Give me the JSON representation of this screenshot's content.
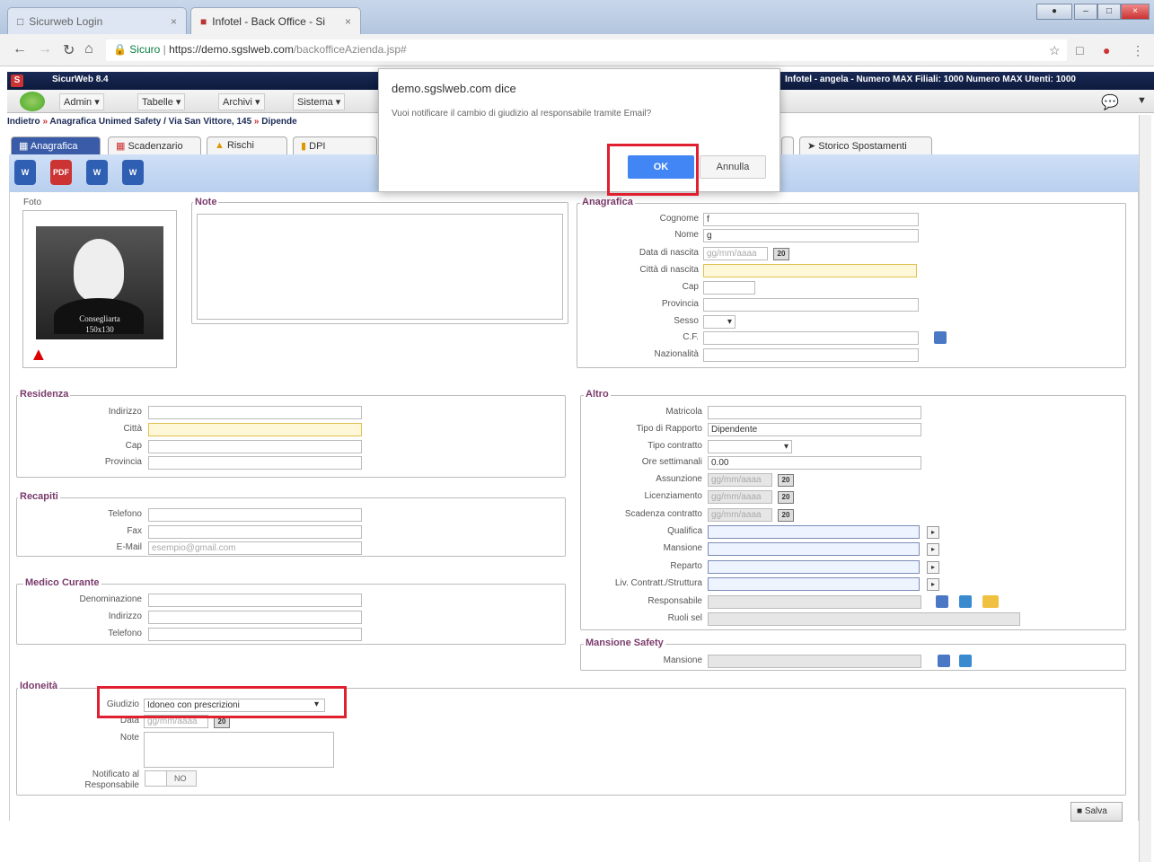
{
  "browser": {
    "tabs": [
      {
        "label": "Sicurweb Login"
      },
      {
        "label": "Infotel - Back Office - Si"
      }
    ],
    "url": {
      "secure": "Sicuro",
      "host": "https://demo.sgslweb.com",
      "path": "/backofficeAzienda.jsp#"
    }
  },
  "app": {
    "title": "SicurWeb 8.4",
    "header_right": "Infotel - angela - Numero MAX Filiali: 1000 Numero MAX Utenti: 1000",
    "menu": [
      "Admin ▾",
      "Tabelle ▾",
      "Archivi ▾",
      "Sistema ▾"
    ]
  },
  "breadcrumb": [
    "Indietro",
    "Anagrafica Unimed Safety / Via San Vittore, 145",
    "Dipende"
  ],
  "page_tabs": [
    "Anagrafica",
    "Scadenzario",
    "Rischi",
    "DPI",
    "Storico Spostamenti"
  ],
  "doc_buttons": [
    "W",
    "PDF",
    "W",
    "W"
  ],
  "foto": {
    "legend": "Foto",
    "caption_1": "Consegliarta",
    "caption_2": "150x130"
  },
  "note": {
    "legend": "Note"
  },
  "anagrafica": {
    "legend": "Anagrafica",
    "cognome_label": "Cognome",
    "cognome_value": "f",
    "nome_label": "Nome",
    "nome_value": "g",
    "data_nascita_label": "Data di nascita",
    "data_nascita_ph": "gg/mm/aaaa",
    "citta_nascita_label": "Città di nascita",
    "cap_label": "Cap",
    "provincia_label": "Provincia",
    "sesso_label": "Sesso",
    "cf_label": "C.F.",
    "nazionalita_label": "Nazionalità"
  },
  "residenza": {
    "legend": "Residenza",
    "indirizzo_label": "Indirizzo",
    "citta_label": "Città",
    "cap_label": "Cap",
    "provincia_label": "Provincia"
  },
  "recapiti": {
    "legend": "Recapiti",
    "telefono_label": "Telefono",
    "fax_label": "Fax",
    "email_label": "E-Mail",
    "email_ph": "esempio@gmail.com"
  },
  "medico": {
    "legend": "Medico Curante",
    "denominazione_label": "Denominazione",
    "indirizzo_label": "Indirizzo",
    "telefono_label": "Telefono"
  },
  "altro": {
    "legend": "Altro",
    "matricola_label": "Matricola",
    "tipo_rapporto_label": "Tipo di Rapporto",
    "tipo_rapporto_value": "Dipendente",
    "tipo_contratto_label": "Tipo contratto",
    "ore_label": "Ore settimanali",
    "ore_value": "0.00",
    "assunzione_label": "Assunzione",
    "date_ph": "gg/mm/aaaa",
    "licenziamento_label": "Licenziamento",
    "scadenza_label": "Scadenza contratto",
    "qualifica_label": "Qualifica",
    "mansione_label": "Mansione",
    "reparto_label": "Reparto",
    "livello_label": "Liv. Contratt./Struttura",
    "responsabile_label": "Responsabile",
    "ruoli_label": "Ruoli sel"
  },
  "mansione_safety": {
    "legend": "Mansione Safety",
    "mansione_label": "Mansione"
  },
  "idoneita": {
    "legend": "Idoneità",
    "giudizio_label": "Giudizio",
    "giudizio_value": "Idoneo con prescrizioni",
    "data_label": "Data",
    "data_ph": "gg/mm/aaaa",
    "note_label": "Note",
    "notificato_label_1": "Notificato al",
    "notificato_label_2": "Responsabile",
    "notificato_value": "NO"
  },
  "cal_label": "20",
  "save_label": "Salva",
  "dialog": {
    "title": "demo.sgslweb.com dice",
    "message": "Vuoi notificare il cambio di giudizio al responsabile tramite Email?",
    "ok": "OK",
    "cancel": "Annulla"
  },
  "colors": {
    "highlight": "#e02030",
    "accent": "#4285f4",
    "legend": "#7a3b6c"
  }
}
